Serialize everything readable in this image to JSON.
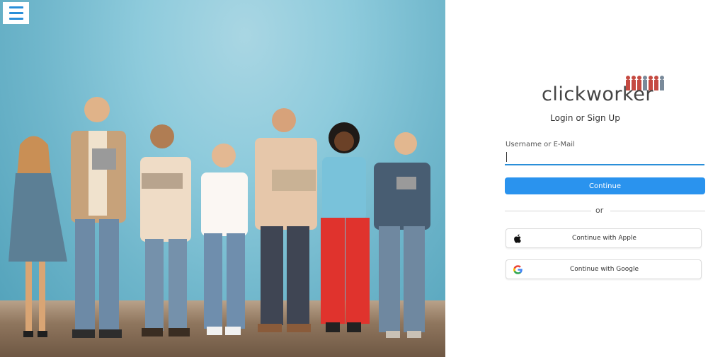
{
  "menu": {
    "icon": "hamburger-menu-icon"
  },
  "brand": {
    "logo_text": "clickworker",
    "accent": "#2a93ee"
  },
  "auth": {
    "subtitle": "Login or Sign Up",
    "username_label": "Username or E-Mail",
    "username_value": "",
    "continue_label": "Continue",
    "or_label": "or",
    "apple_label": "Continue with Apple",
    "google_label": "Continue with Google"
  }
}
